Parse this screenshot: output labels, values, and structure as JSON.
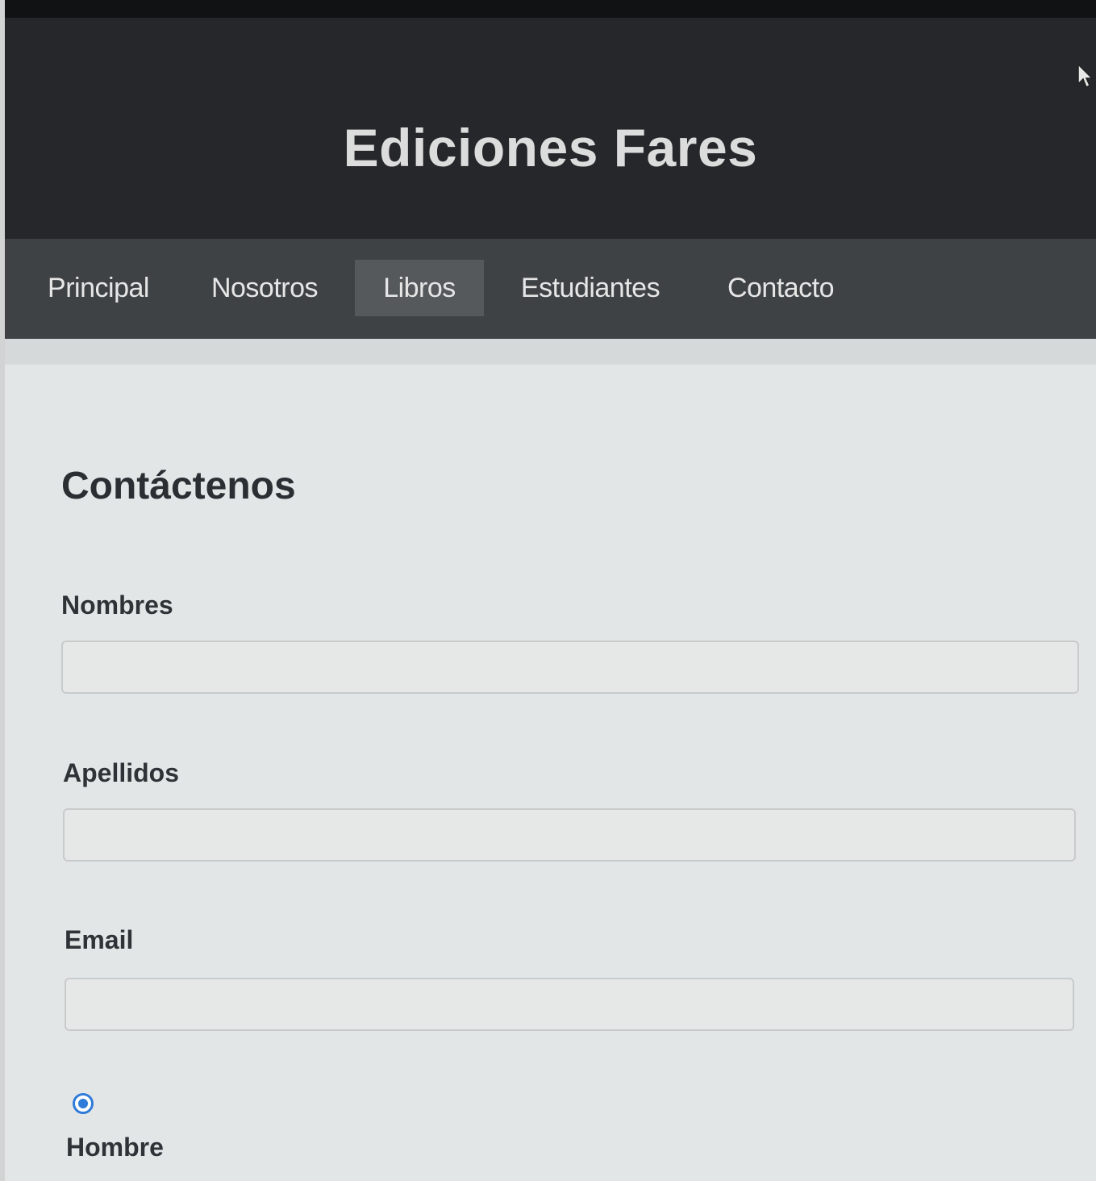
{
  "header": {
    "title": "Ediciones Fares"
  },
  "nav": {
    "items": [
      {
        "label": "Principal",
        "active": false
      },
      {
        "label": "Nosotros",
        "active": false
      },
      {
        "label": "Libros",
        "active": true
      },
      {
        "label": "Estudiantes",
        "active": false
      },
      {
        "label": "Contacto",
        "active": false
      }
    ]
  },
  "contact": {
    "title": "Contáctenos",
    "fields": [
      {
        "label": "Nombres",
        "value": "",
        "placeholder": ""
      },
      {
        "label": "Apellidos",
        "value": "",
        "placeholder": ""
      },
      {
        "label": "Email",
        "value": "",
        "placeholder": ""
      }
    ],
    "gender": {
      "option_label": "Hombre",
      "checked": true
    }
  },
  "colors": {
    "header_bg": "#25272a",
    "nav_bg": "#3e4245",
    "nav_active_bg": "#55595c",
    "content_bg": "#e3e6e6",
    "radio_accent": "#2f7bd9"
  },
  "icons": {
    "cursor": "mouse-pointer-icon"
  }
}
